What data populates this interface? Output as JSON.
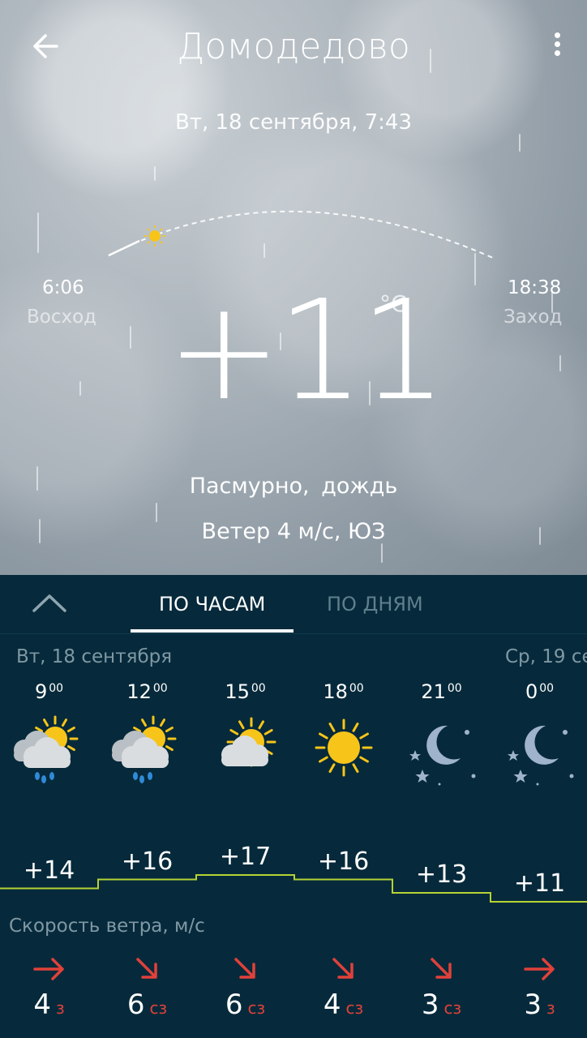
{
  "header": {
    "city": "Домодедово",
    "date": "Вт, 18 сентября, 7:43"
  },
  "sun": {
    "sunrise_time": "6:06",
    "sunrise_label": "Восход",
    "sunset_time": "18:38",
    "sunset_label": "Заход"
  },
  "current": {
    "temp": "+11",
    "unit": "°C",
    "condition": "Пасмурно,  дождь",
    "wind": "Ветер 4 м/с, ЮЗ"
  },
  "tabs": {
    "hourly": "ПО ЧАСАМ",
    "daily": "ПО ДНЯМ"
  },
  "days": {
    "today": "Вт, 18 сентября",
    "tomorrow": "Ср, 19 се"
  },
  "hourly": [
    {
      "hour": "9",
      "min": "00",
      "icon": "partly-cloudy-rain-icon",
      "temp": "+14",
      "value": 14,
      "wind_speed": "4",
      "wind_dir": "з"
    },
    {
      "hour": "12",
      "min": "00",
      "icon": "partly-cloudy-rain-icon",
      "temp": "+16",
      "value": 16,
      "wind_speed": "6",
      "wind_dir": "сз"
    },
    {
      "hour": "15",
      "min": "00",
      "icon": "partly-cloudy-icon",
      "temp": "+17",
      "value": 17,
      "wind_speed": "6",
      "wind_dir": "сз"
    },
    {
      "hour": "18",
      "min": "00",
      "icon": "sun-icon",
      "temp": "+16",
      "value": 16,
      "wind_speed": "4",
      "wind_dir": "сз"
    },
    {
      "hour": "21",
      "min": "00",
      "icon": "moon-stars-icon",
      "temp": "+13",
      "value": 13,
      "wind_speed": "3",
      "wind_dir": "сз"
    },
    {
      "hour": "0",
      "min": "00",
      "icon": "moon-stars-icon",
      "temp": "+11",
      "value": 11,
      "wind_speed": "3",
      "wind_dir": "з"
    }
  ],
  "wind_section": {
    "title": "Скорость ветра, м/с"
  },
  "colors": {
    "panel_bg": "#062a3b",
    "graph_line": "#b5d334",
    "wind_arrow": "#e0413a"
  }
}
